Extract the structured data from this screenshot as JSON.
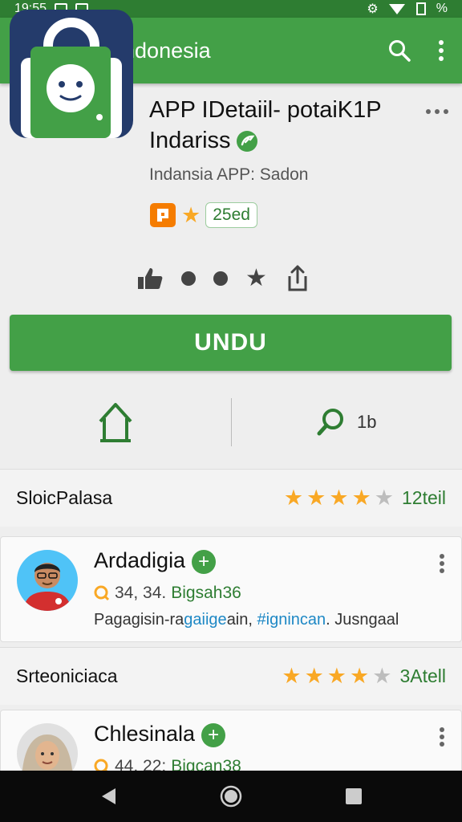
{
  "status": {
    "time": "19:55",
    "battery": "%"
  },
  "appbar": {
    "title": "PK Indonesia"
  },
  "app": {
    "title_line1": "APP IDetaiil- potaiK1P",
    "title_line2": "Indariss",
    "subtitle": "Indansia APP: Sadon",
    "rating_label": "25ed",
    "install_label": "UNDU"
  },
  "stats": {
    "search_count": "1b"
  },
  "sections": [
    {
      "label": "SloicPalasa",
      "rating": 4,
      "count": "12teil"
    },
    {
      "label": "Srteoniciaca",
      "rating": 4,
      "count": "3Atell"
    }
  ],
  "reviews": [
    {
      "name": "Ardadigia",
      "nums": "34, 34.",
      "tag": "Bigsah36",
      "text_a": "Pagagisin-ra",
      "text_b": "gaiige",
      "text_c": "ain, ",
      "text_d": "#ignincan",
      "text_e": ". Jusngaal"
    },
    {
      "name": "Chlesinala",
      "nums": "44, 22:",
      "tag": "Bigcan38"
    }
  ],
  "colors": {
    "primary": "#43a047",
    "dark": "#2e7d32",
    "star": "#f9a825",
    "icon_bg": "#243b6b"
  }
}
